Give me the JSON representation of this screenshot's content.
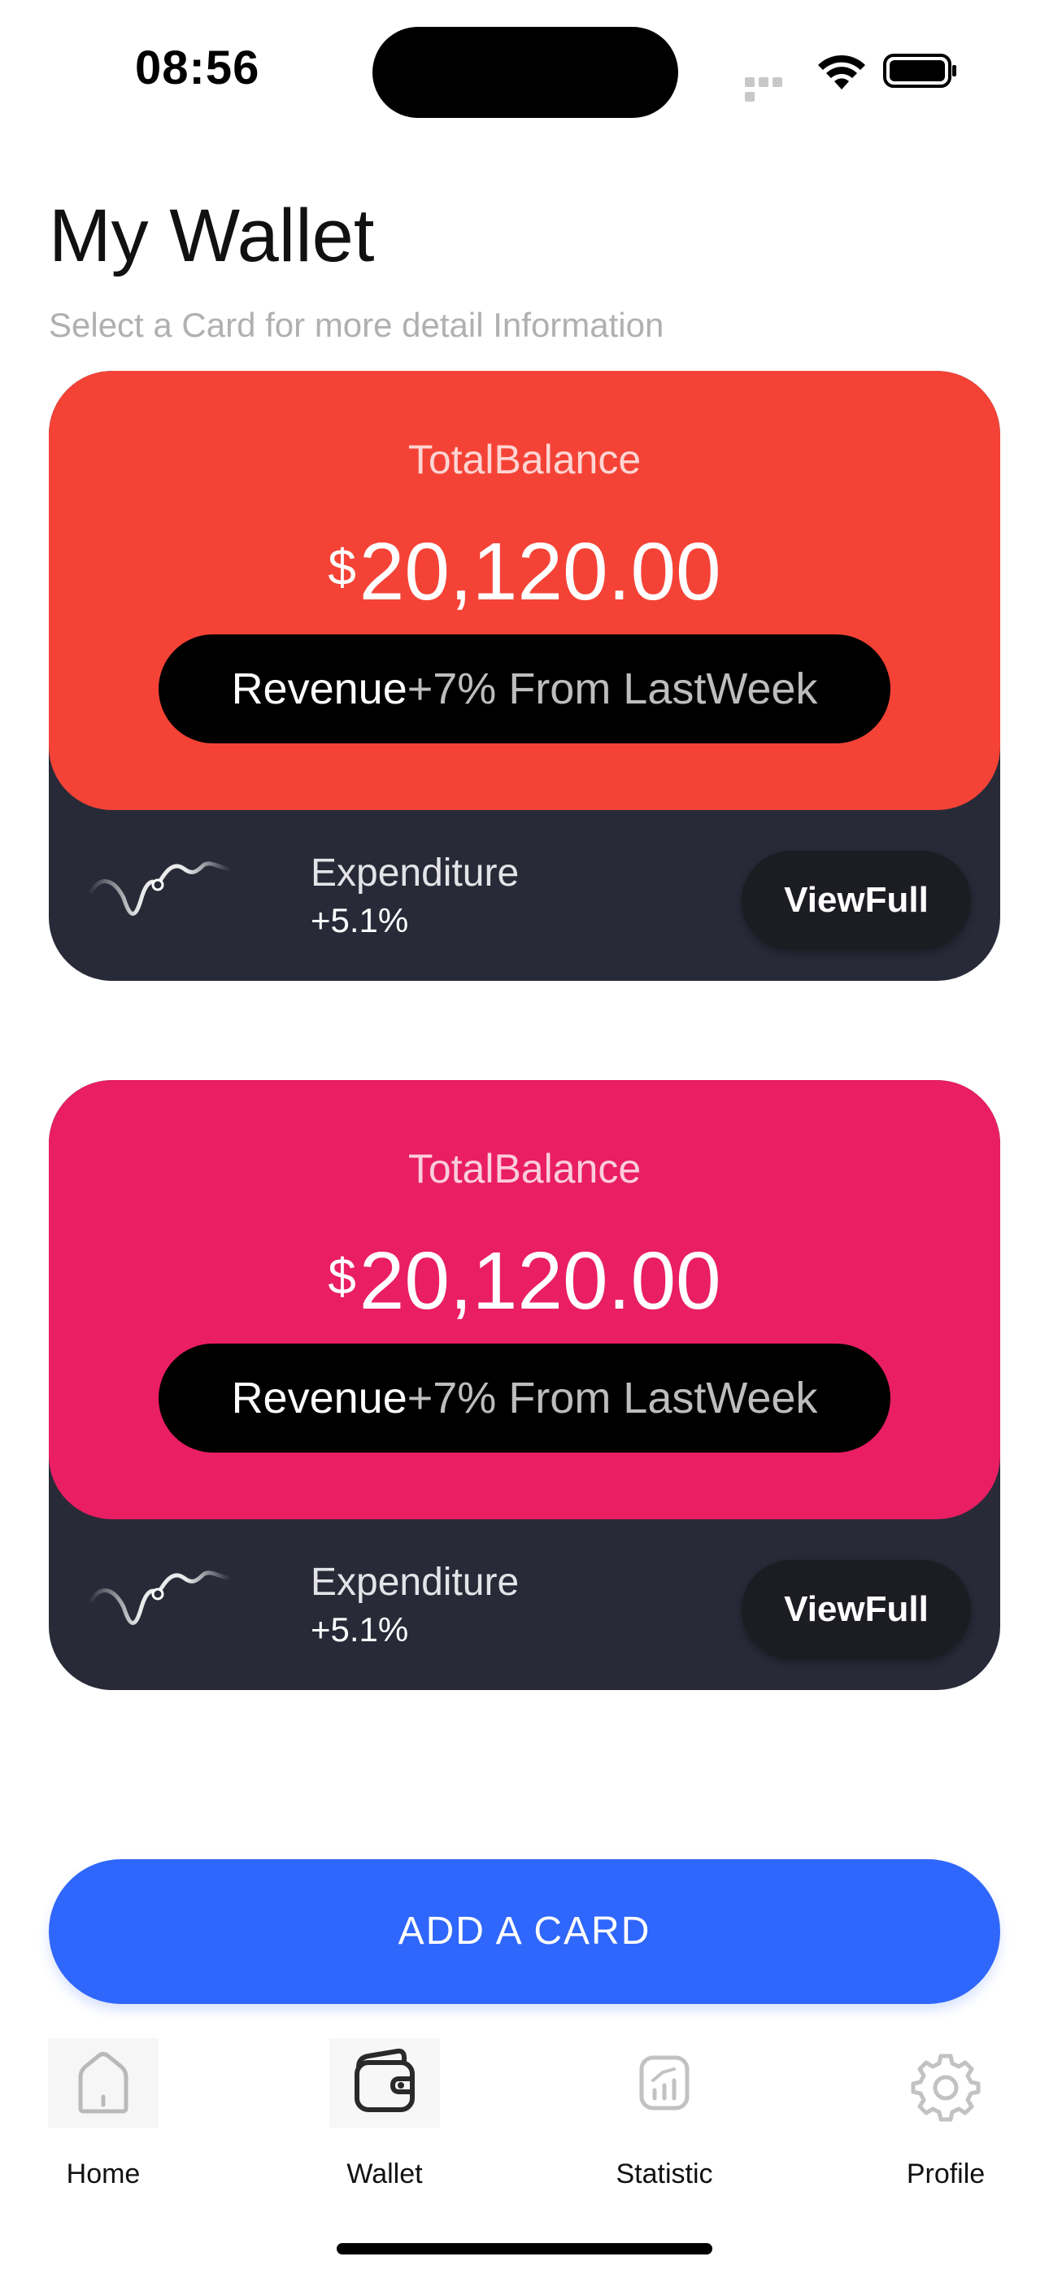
{
  "status_bar": {
    "time": "08:56"
  },
  "header": {
    "title": "My Wallet",
    "subtitle": "Select a Card for more detail Information"
  },
  "cards": [
    {
      "label": "TotalBalance",
      "currency": "$",
      "amount": "20,120.00",
      "revenue_label": "Revenue",
      "revenue_change": "+7% From LastWeek",
      "expenditure_label": "Expenditure",
      "expenditure_value": "+5.1%",
      "button_label": "ViewFull",
      "color": "#f44336"
    },
    {
      "label": "TotalBalance",
      "currency": "$",
      "amount": "20,120.00",
      "revenue_label": "Revenue",
      "revenue_change": "+7% From LastWeek",
      "expenditure_label": "Expenditure",
      "expenditure_value": "+5.1%",
      "button_label": "ViewFull",
      "color": "#e91e63"
    }
  ],
  "add_card_button": "ADD A CARD",
  "nav": {
    "items": [
      {
        "label": "Home",
        "icon": "home-icon"
      },
      {
        "label": "Wallet",
        "icon": "wallet-icon"
      },
      {
        "label": "Statistic",
        "icon": "statistic-icon"
      },
      {
        "label": "Profile",
        "icon": "gear-icon"
      }
    ],
    "active": "Wallet"
  },
  "colors": {
    "card_bottom": "#292a38",
    "accent_blue": "#2f66fb",
    "pill": "#000000"
  }
}
